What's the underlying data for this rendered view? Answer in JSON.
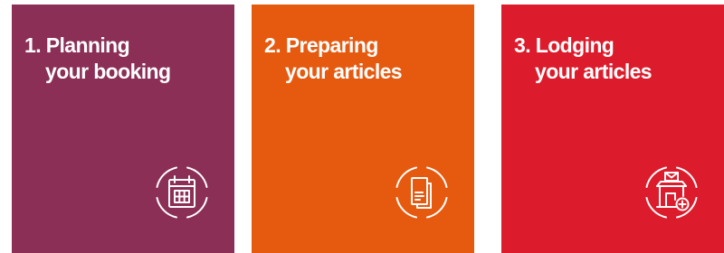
{
  "cards": [
    {
      "title_line1": "1. Planning",
      "title_line2": "your booking",
      "color": "#8b2f57",
      "icon": "calendar-icon"
    },
    {
      "title_line1": "2. Preparing",
      "title_line2": "your articles",
      "color": "#e65a10",
      "icon": "documents-icon"
    },
    {
      "title_line1": "3. Lodging",
      "title_line2": "your articles",
      "color": "#dc1c2c",
      "icon": "post-office-icon"
    }
  ]
}
